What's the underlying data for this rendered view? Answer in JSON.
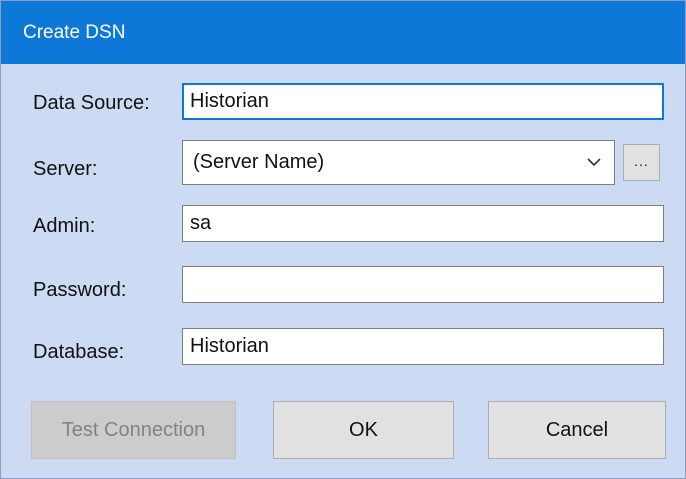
{
  "window": {
    "title": "Create DSN"
  },
  "form": {
    "data_source": {
      "label": "Data Source:",
      "value": "Historian"
    },
    "server": {
      "label": "Server:",
      "value": "(Server Name)",
      "browse_label": "..."
    },
    "admin": {
      "label": "Admin:",
      "value": "sa"
    },
    "password": {
      "label": "Password:",
      "value": ""
    },
    "database": {
      "label": "Database:",
      "value": "Historian"
    }
  },
  "buttons": {
    "test_connection": "Test Connection",
    "ok": "OK",
    "cancel": "Cancel"
  },
  "colors": {
    "titlebar": "#0d78d8",
    "dialog_background": "#ccdaf4",
    "focus_border": "#0d78d8",
    "disabled_text": "#838383"
  },
  "icons": {
    "server_dropdown": "chevron-down-icon"
  }
}
